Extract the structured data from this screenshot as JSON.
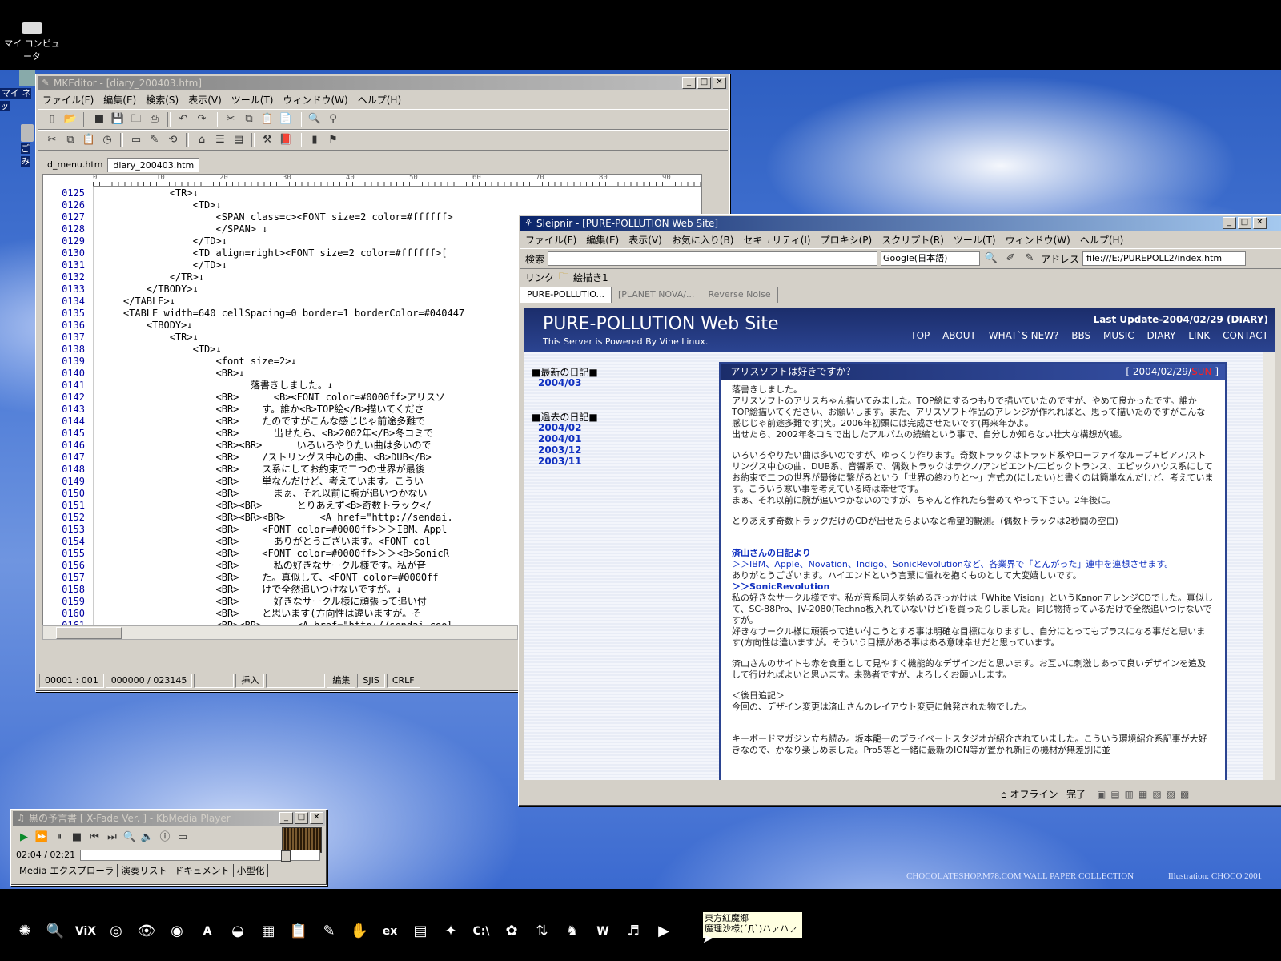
{
  "desktop": {
    "icon_my_computer": "マイ コンピュータ",
    "icon_my_network": "マイ ネッ",
    "icon_trash": "ごみ",
    "wallpaper_credit": "CHOCOLATESHOP.M78.COM WALL PAPER COLLECTION",
    "wallpaper_illustration": "Illustration: CHOCO 2001"
  },
  "mkeditor": {
    "title": "MKEditor - [diary_200403.htm]",
    "menu": [
      "ファイル(F)",
      "編集(E)",
      "検索(S)",
      "表示(V)",
      "ツール(T)",
      "ウィンドウ(W)",
      "ヘルプ(H)"
    ],
    "tabs": [
      "d_menu.htm",
      "diary_200403.htm"
    ],
    "ruler_ticks": [
      "0",
      "10",
      "20",
      "30",
      "40",
      "50",
      "60",
      "70",
      "80",
      "90"
    ],
    "lines": [
      {
        "n": "0125",
        "code": "            <TR>↓"
      },
      {
        "n": "0126",
        "code": "                <TD>↓"
      },
      {
        "n": "0127",
        "code": "                    <SPAN class=c><FONT size=2 color=#ffffff>"
      },
      {
        "n": "0128",
        "code": "                    </SPAN> ↓"
      },
      {
        "n": "0129",
        "code": "                </TD>↓"
      },
      {
        "n": "0130",
        "code": "                <TD align=right><FONT size=2 color=#ffffff>["
      },
      {
        "n": "0131",
        "code": "                </TD>↓"
      },
      {
        "n": "0132",
        "code": "            </TR>↓"
      },
      {
        "n": "0133",
        "code": "        </TBODY>↓"
      },
      {
        "n": "0134",
        "code": "    </TABLE>↓"
      },
      {
        "n": "0135",
        "code": "    <TABLE width=640 cellSpacing=0 border=1 borderColor=#040447"
      },
      {
        "n": "0136",
        "code": "        <TBODY>↓"
      },
      {
        "n": "0137",
        "code": "            <TR>↓"
      },
      {
        "n": "0138",
        "code": "                <TD>↓"
      },
      {
        "n": "0139",
        "code": "                    <font size=2>↓"
      },
      {
        "n": "0140",
        "code": "                    <BR>↓"
      },
      {
        "n": "0141",
        "code": "                          落書きしました。↓"
      },
      {
        "n": "0142",
        "code": "                    <BR>      <B><FONT color=#0000ff>アリスソ"
      },
      {
        "n": "0143",
        "code": "                    <BR>    す。誰か<B>TOP絵</B>描いてくださ"
      },
      {
        "n": "0144",
        "code": "                    <BR>    たのですがこんな感じじゃ前途多難で"
      },
      {
        "n": "0145",
        "code": "                    <BR>      出せたら、<B>2002年</B>冬コミで"
      },
      {
        "n": "0146",
        "code": "                    <BR><BR>      いろいろやりたい曲は多いので"
      },
      {
        "n": "0147",
        "code": "                    <BR>    /ストリングス中心の曲、<B>DUB</B>"
      },
      {
        "n": "0148",
        "code": "                    <BR>    ス系にしてお約束で二つの世界が最後"
      },
      {
        "n": "0149",
        "code": "                    <BR>    単なんだけど、考えています。こうい"
      },
      {
        "n": "0150",
        "code": "                    <BR>      まぁ、それ以前に腕が追いつかない"
      },
      {
        "n": "0151",
        "code": "                    <BR><BR>      とりあえず<B>奇数トラック</"
      },
      {
        "n": "0152",
        "code": "                    <BR><BR><BR>      <A href=\"http://sendai."
      },
      {
        "n": "0153",
        "code": "                    <BR>    <FONT color=#0000ff>＞＞IBM、Appl"
      },
      {
        "n": "0154",
        "code": "                    <BR>      ありがとうございます。<FONT col"
      },
      {
        "n": "0155",
        "code": "                    <BR>    <FONT color=#0000ff>＞＞<B>SonicR"
      },
      {
        "n": "0156",
        "code": "                    <BR>      私の好きなサークル様です。私が音"
      },
      {
        "n": "0157",
        "code": "                    <BR>    た。真似して、<FONT color=#0000ff"
      },
      {
        "n": "0158",
        "code": "                    <BR>    けで全然追いつけないですが。↓"
      },
      {
        "n": "0159",
        "code": "                    <BR>      好きなサークル様に頑張って追い付"
      },
      {
        "n": "0160",
        "code": "                    <BR>    と思います(方向性は違いますが。そ"
      },
      {
        "n": "0161",
        "code": "                    <BR><BR>      <A href=\"http://sendai.cool"
      }
    ],
    "status": [
      "00001 : 001",
      "000000 / 023145",
      "挿入",
      "編集",
      "SJIS",
      "CRLF"
    ]
  },
  "sleipnir": {
    "title": "Sleipnir - [PURE-POLLUTION Web Site]",
    "menu": [
      "ファイル(F)",
      "編集(E)",
      "表示(V)",
      "お気に入り(B)",
      "セキュリティ(I)",
      "プロキシ(P)",
      "スクリプト(R)",
      "ツール(T)",
      "ウィンドウ(W)",
      "ヘルプ(H)"
    ],
    "search_label": "検索",
    "search_engine": "Google(日本語)",
    "address_label": "アドレス",
    "address_value": "file:///E:/PUREPOLL2/index.htm",
    "links_label": "リンク",
    "links_item": "絵描き1",
    "tabs": [
      "PURE-POLLUTIO...",
      "[PLANET NOVA/...",
      "Reverse Noise"
    ],
    "status_offline": "オフライン",
    "status_done": "完了",
    "site": {
      "title": "PURE-POLLUTION Web Site",
      "subtitle": "This Server is Powered By Vine Linux.",
      "last_update": "Last Update-2004/02/29 (DIARY)",
      "nav": [
        "TOP",
        "ABOUT",
        "WHAT`S NEW?",
        "BBS",
        "MUSIC",
        "DIARY",
        "LINK",
        "CONTACT"
      ],
      "latest_label": "■最新の日記■",
      "latest": [
        "2004/03"
      ],
      "past_label": "■過去の日記■",
      "past": [
        "2004/02",
        "2004/01",
        "2003/12",
        "2003/11"
      ],
      "diary_title": "-アリスソフトは好きですか？-",
      "diary_date": "2004/02/29/",
      "diary_dow": "SUN",
      "paragraphs": [
        "落書きしました。",
        "アリスソフトのアリスちゃん描いてみました。TOP絵にするつもりで描いていたのですが、やめて良かったです。誰かTOP絵描いてください、お願いします。また、アリスソフト作品のアレンジが作れればと、思って描いたのですがこんな感じじゃ前途多難です(笑。2006年初頭には完成させたいです(再来年かよ。",
        "出せたら、2002年冬コミで出したアルバムの続編という事で、自分しか知らない壮大な構想が(嘘。",
        "いろいろやりたい曲は多いのですが、ゆっくり作ります。奇数トラックはトラッド系やローファイなループ+ピアノ/ストリングス中心の曲、DUB系、音響系で、偶数トラックはテクノ/アンビエント/エピックトランス、エピックハウス系にしてお約束で二つの世界が最後に繋がるという「世界の終わりと〜」方式の(にしたい)と書くのは簡単なんだけど、考えています。こういう寒い事を考えている時は幸せです。",
        "まぁ、それ以前に腕が追いつかないのですが、ちゃんと作れたら誉めてやって下さい。2年後に。",
        "とりあえず奇数トラックだけのCDが出せたらよいなと希望的観測。(偶数トラックは2秒間の空白)",
        "済山さんの日記より",
        "＞＞IBM、Apple、Novation、Indigo、SonicRevolutionなど、各業界で「とんがった」連中を連想させます。",
        "ありがとうございます。ハイエンドという言葉に憧れを抱くものとして大変嬉しいです。",
        "＞＞SonicRevolution",
        "私の好きなサークル様です。私が音系同人を始めるきっかけは「White Vision」というKanonアレンジCDでした。真似して、SC-88Pro、JV-2080(Techno板入れていないけど)を買ったりしました。同じ物持っているだけで全然追いつけないですが。",
        "好きなサークル様に頑張って追い付こうとする事は明確な目標になりますし、自分にとってもプラスになる事だと思います(方向性は違いますが。そういう目標がある事はある意味幸せだと思っています。",
        "済山さんのサイトも赤を食重として見やすく機能的なデザインだと思います。お互いに刺激しあって良いデザインを追及して行ければよいと思います。未熟者ですが、よろしくお願いします。",
        "＜後日追記＞",
        "今回の、デザイン変更は済山さんのレイアウト変更に触発された物でした。",
        "キーボードマガジン立ち読み。坂本龍一のプライベートスタジオが紹介されていました。こういう環境紹介系記事が大好きなので、かなり楽しめました。Pro5等と一緒に最新のION等が置かれ新旧の機材が無差別に並"
      ]
    }
  },
  "player": {
    "title": "黒の予言書 [ X-Fade Ver. ] - KbMedia Player",
    "time": "02:04 / 02:21",
    "tabs": [
      "Media エクスプローラ",
      "演奏リスト",
      "ドキュメント",
      "小型化"
    ]
  },
  "taskbar": {
    "tooltip_line1": "東方紅魔郷",
    "tooltip_line2": "魔理沙様(´Д`)ハァハァ",
    "icons": [
      "app-icon",
      "search-icon",
      "vix-icon",
      "media-icon",
      "eye-icon",
      "audio-icon",
      "font-icon",
      "disc-icon",
      "calc-icon",
      "clipboard-icon",
      "mkeditor-icon",
      "handshake-icon",
      "ex-icon",
      "ffmpeg-icon",
      "bird-icon",
      "console-icon",
      "flower-icon",
      "ftp-icon",
      "dragon-icon",
      "word-icon",
      "midi-icon",
      "player-icon"
    ],
    "vix_label": "ViX",
    "console_label": "C:\\",
    "word_label": "W",
    "ex_label": "ex",
    "font_label": "A"
  },
  "colors": {
    "title_active": "#0a246a",
    "site_header": "#1b2d6b",
    "link_blue": "#1030c0",
    "sunday_red": "#ff2020"
  }
}
